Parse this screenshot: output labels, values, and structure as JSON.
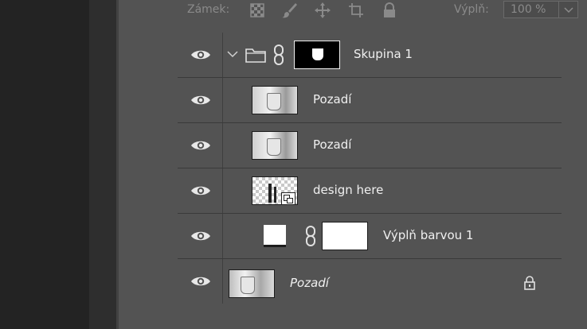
{
  "lock_bar": {
    "label": "Zámek:",
    "icons": [
      "checker-lock-icon",
      "brush-lock-icon",
      "move-lock-icon",
      "artboard-lock-icon",
      "padlock-icon"
    ],
    "fill_label": "Výplň:",
    "fill_value": "100 %"
  },
  "layers": [
    {
      "name": "Skupina 1",
      "kind": "group",
      "italic": false
    },
    {
      "name": "Pozadí",
      "kind": "image",
      "italic": false
    },
    {
      "name": "Pozadí",
      "kind": "image",
      "italic": false
    },
    {
      "name": "design here",
      "kind": "smart",
      "italic": false
    },
    {
      "name": "Výplň barvou 1",
      "kind": "fill",
      "italic": false
    },
    {
      "name": "Pozadí",
      "kind": "background",
      "italic": true,
      "locked": true
    }
  ],
  "colors": {
    "panel_bg": "#535353",
    "row_border": "#3a3a3a",
    "dark_left": "#232323",
    "text": "#f0f0f0",
    "muted": "#8a8a8a"
  }
}
